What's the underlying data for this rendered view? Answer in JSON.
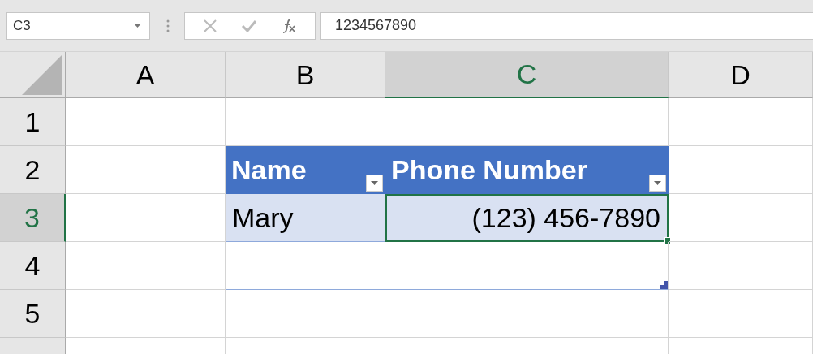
{
  "name_box": {
    "value": "C3"
  },
  "formula_bar": {
    "value": "1234567890"
  },
  "columns": [
    {
      "label": "A",
      "selected": false
    },
    {
      "label": "B",
      "selected": false
    },
    {
      "label": "C",
      "selected": true
    },
    {
      "label": "D",
      "selected": false
    }
  ],
  "rows": [
    {
      "label": "1",
      "selected": false
    },
    {
      "label": "2",
      "selected": false
    },
    {
      "label": "3",
      "selected": true
    },
    {
      "label": "4",
      "selected": false
    },
    {
      "label": "5",
      "selected": false
    }
  ],
  "table": {
    "header": [
      {
        "text": "Name"
      },
      {
        "text": "Phone Number"
      }
    ],
    "rows": [
      [
        {
          "text": "Mary",
          "kind": "text",
          "selected": false
        },
        {
          "text": "(123) 456-7890",
          "kind": "number",
          "selected": true
        }
      ]
    ]
  }
}
